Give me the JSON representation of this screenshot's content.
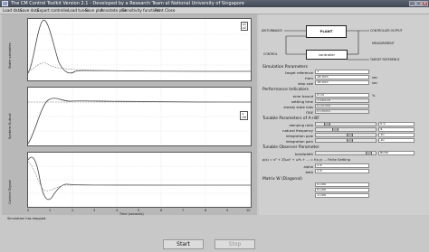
{
  "window": {
    "title": "The CM Control Toolkit  Version 2.1 - Developed by a Research Team at National University of Singapore",
    "minimize_glyph": "_",
    "maximize_glyph": "□",
    "close_glyph": "×"
  },
  "menu": [
    "Load data",
    "Save data",
    "Export controller",
    "Load tuner",
    "Save plot",
    "Annotate plot",
    "Sensitivity functions",
    "Print",
    "Close"
  ],
  "plots": {
    "ylabels": [
      "State variables",
      "System Output",
      "Control Signal"
    ],
    "xlabel": "Time (seconds)",
    "legend1": [
      "x1",
      "x2"
    ],
    "legend2": [
      "y",
      "ref"
    ],
    "xticks": [
      "0",
      "1",
      "2",
      "3",
      "4",
      "5",
      "6",
      "7",
      "8",
      "9",
      "10"
    ]
  },
  "diagram": {
    "plant": "PLANT",
    "controller": "controller",
    "disturbance": "DISTURBANCE",
    "controller_output": "CONTROLLER OUTPUT",
    "measurement": "MEASUREMENT",
    "control": "CONTROL",
    "target_reference": "TARGET REFERENCE"
  },
  "simulation": {
    "header": "Simulation Parameters",
    "fields": [
      {
        "label": "target reference",
        "value": "1",
        "unit": ""
      },
      {
        "label": "from",
        "value": "1e-005",
        "unit": "sec"
      },
      {
        "label": "step size",
        "value": "1e-005",
        "unit": "sec"
      }
    ]
  },
  "performance": {
    "header": "Performance Indicators",
    "fields": [
      {
        "label": "error bound",
        "value": "0.05",
        "unit": "%"
      },
      {
        "label": "settling time",
        "value": "1.88436",
        "unit": ""
      },
      {
        "label": "steady state bias",
        "value": "0.00788",
        "unit": ""
      },
      {
        "label": "ITAE",
        "value": "0.00060",
        "unit": ""
      }
    ]
  },
  "tunable": {
    "header": "Tunable Parameters of A+BF",
    "fields": [
      {
        "label": "damping ratio",
        "value": "0.5",
        "level": 0.15
      },
      {
        "label": "natural frequency",
        "value": "4",
        "level": 0.3
      },
      {
        "label": "integration pole",
        "value": "10",
        "level": 0.55
      },
      {
        "label": "integration gain",
        "value": "10",
        "level": 0.55
      }
    ]
  },
  "observer": {
    "header": "Tunable Observer Parameter",
    "fields": [
      {
        "label": "bandwidth",
        "value": "6000",
        "level": 0.9
      }
    ],
    "formula": "p(s) = s³ + 2ζωs² + ω²s + ... = f(x,y) ... Finite Settling"
  },
  "matrix": {
    "rows": [
      {
        "label": "alpha",
        "value": "2.4"
      },
      {
        "label": "beta",
        "value": "2.6"
      }
    ],
    "header": "Matrix W (Diagonal)",
    "values": [
      "0.000",
      "0.000",
      "1.000"
    ]
  },
  "buttons": {
    "start": "Start",
    "stop": "Stop"
  },
  "status": "Simulation has stopped.",
  "colors": {
    "plot_bg": "#ffffff",
    "curve": "#555555",
    "panel": "#cfcfcf"
  }
}
